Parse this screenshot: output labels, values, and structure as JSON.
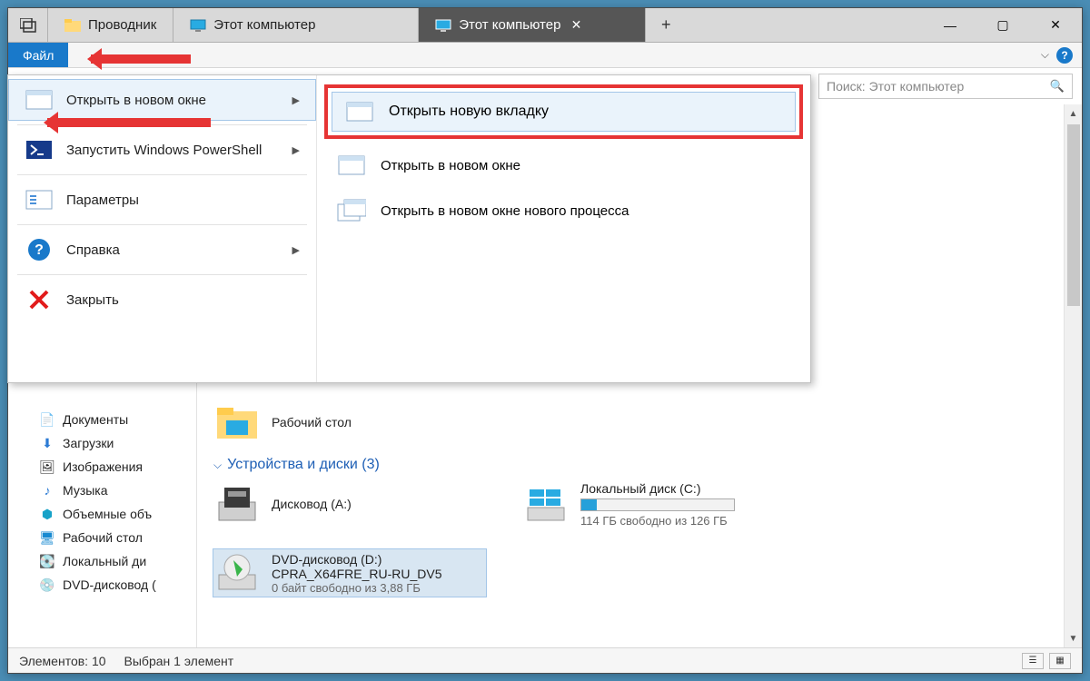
{
  "tabs": {
    "items": [
      {
        "label": "Проводник"
      },
      {
        "label": "Этот компьютер"
      },
      {
        "label": "Этот компьютер"
      }
    ],
    "newtab": "+"
  },
  "window_controls": {
    "min": "—",
    "max": "▢",
    "close": "✕"
  },
  "ribbon": {
    "file": "Файл"
  },
  "search": {
    "placeholder": "Поиск: Этот компьютер"
  },
  "file_menu": {
    "left": [
      {
        "label": "Открыть в новом окне",
        "has_sub": true,
        "hover": true
      },
      {
        "label": "Запустить Windows PowerShell",
        "has_sub": true
      },
      {
        "label": "Параметры"
      },
      {
        "label": "Справка",
        "has_sub": true
      },
      {
        "label": "Закрыть"
      }
    ],
    "right": [
      {
        "label": "Открыть новую вкладку",
        "highlight": true
      },
      {
        "label": "Открыть в новом окне"
      },
      {
        "label": "Открыть в новом окне нового процесса"
      }
    ]
  },
  "sidebar": [
    {
      "label": "Документы",
      "icon": "doc"
    },
    {
      "label": "Загрузки",
      "icon": "down"
    },
    {
      "label": "Изображения",
      "icon": "img"
    },
    {
      "label": "Музыка",
      "icon": "music"
    },
    {
      "label": "Объемные объ",
      "icon": "cube"
    },
    {
      "label": "Рабочий стол",
      "icon": "desk"
    },
    {
      "label": "Локальный ди",
      "icon": "disk"
    },
    {
      "label": "DVD-дисковод (",
      "icon": "dvd"
    }
  ],
  "main": {
    "folders_sample": {
      "label": "Рабочий стол"
    },
    "section_devices": {
      "title": "Устройства и диски (3)"
    },
    "devices": [
      {
        "name": "Дисковод (A:)"
      },
      {
        "name": "Локальный диск (C:)",
        "free": "114 ГБ свободно из 126 ГБ",
        "fill_pct": 10
      },
      {
        "name": "DVD-дисковод (D:)",
        "sub1": "CPRA_X64FRE_RU-RU_DV5",
        "sub2": "0 байт свободно из 3,88 ГБ",
        "selected": true
      }
    ]
  },
  "status": {
    "count": "Элементов: 10",
    "selected": "Выбран 1 элемент"
  }
}
